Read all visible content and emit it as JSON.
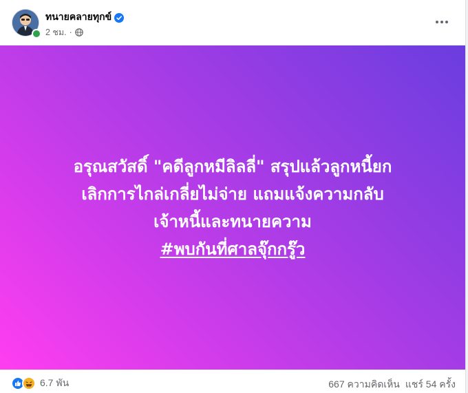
{
  "post": {
    "author": "ทนายคลายทุกข์",
    "time": "2 ชม.",
    "separator": "·",
    "lines": [
      "อรุณสวัสดิ์ \"คดีลูกหมีลิลลี่\" สรุปแล้วลูกหนี้ยก",
      "เลิกการไกล่เกลี่ยไม่จ่าย แถมแจ้งความกลับ",
      "เจ้าหนี้และทนายความ"
    ],
    "hashtag": "#พบกันที่ศาลจุ๊กกรู๊ว"
  },
  "footer": {
    "reactions_count": "6.7 พัน",
    "comments": "667 ความคิดเห็น",
    "shares": "แชร์ 54 ครั้ง"
  },
  "icons": {
    "verified": "verified-badge-icon",
    "privacy": "globe-icon",
    "more": "more-options-icon",
    "reactions": [
      "like-icon",
      "haha-icon"
    ]
  },
  "colors": {
    "gradient_start": "#ff3df0",
    "gradient_end": "#6a3ddf",
    "verified_blue": "#1877f2",
    "meta_gray": "#65676b"
  }
}
